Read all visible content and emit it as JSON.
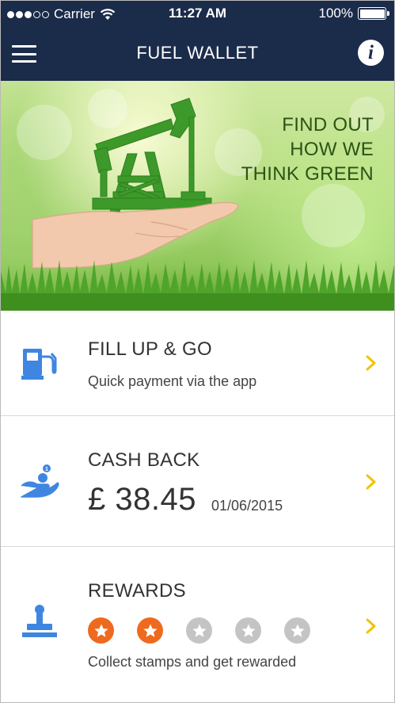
{
  "status_bar": {
    "carrier": "Carrier",
    "time": "11:27 AM",
    "battery": "100%",
    "signal_bars_filled": 3,
    "signal_bars_total": 5
  },
  "nav": {
    "title": "FUEL WALLET",
    "menu_icon": "hamburger-menu-icon",
    "info_icon": "info-icon",
    "info_glyph": "i"
  },
  "hero": {
    "lines": [
      "FIND OUT",
      "HOW WE",
      "THINK GREEN"
    ]
  },
  "fill_up": {
    "title": "FILL UP & GO",
    "subtitle": "Quick payment via the app",
    "icon": "fuel-pump-icon"
  },
  "cash_back": {
    "title": "CASH BACK",
    "amount": "£ 38.45",
    "date": "01/06/2015",
    "icon": "hand-coins-icon"
  },
  "rewards": {
    "title": "REWARDS",
    "subtitle": "Collect stamps and get rewarded",
    "stamps_collected": 2,
    "stamps_total": 5,
    "icon": "stamp-icon"
  },
  "colors": {
    "navbar": "#1b2b4a",
    "accent_blue": "#3f86e0",
    "chevron_yellow": "#f2c200",
    "stamp_active": "#ee6a1e",
    "stamp_inactive": "#c4c4c4",
    "hero_text": "#2c5316"
  }
}
